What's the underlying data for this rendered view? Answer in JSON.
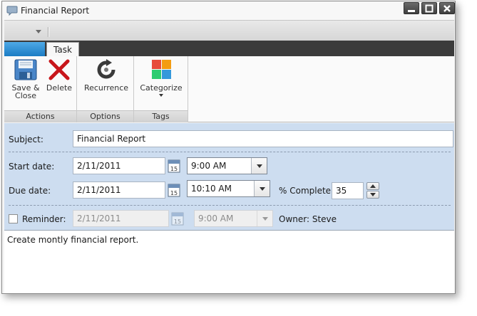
{
  "window": {
    "title": "Financial Report"
  },
  "tabs": {
    "task": "Task"
  },
  "ribbon": {
    "actions": {
      "label": "Actions",
      "save_line1": "Save &",
      "save_line2": "Close",
      "delete": "Delete"
    },
    "options": {
      "label": "Options",
      "recurrence": "Recurrence"
    },
    "tags": {
      "label": "Tags",
      "categorize": "Categorize"
    }
  },
  "form": {
    "subject_label": "Subject:",
    "subject_value": "Financial Report",
    "start_label": "Start date:",
    "start_date": "2/11/2011",
    "start_time": "9:00 AM",
    "due_label": "Due date:",
    "due_date": "2/11/2011",
    "due_time": "10:10 AM",
    "complete_label": "% Complete:",
    "complete_value": "35",
    "reminder_label": "Reminder:",
    "reminder_date": "2/11/2011",
    "reminder_time": "9:00 AM",
    "owner": "Owner: Steve",
    "calendar_day": "15"
  },
  "notes": {
    "text": "Create montly financial report."
  },
  "colors": {
    "accent": "#1b7cc4",
    "form_bg": "#cdddf0",
    "tabstrip": "#3b3b3b"
  },
  "icons": [
    "speech-bubble-icon",
    "minimize-icon",
    "maximize-icon",
    "close-icon",
    "save-icon",
    "delete-icon",
    "recurrence-icon",
    "categorize-icon",
    "calendar-icon"
  ]
}
